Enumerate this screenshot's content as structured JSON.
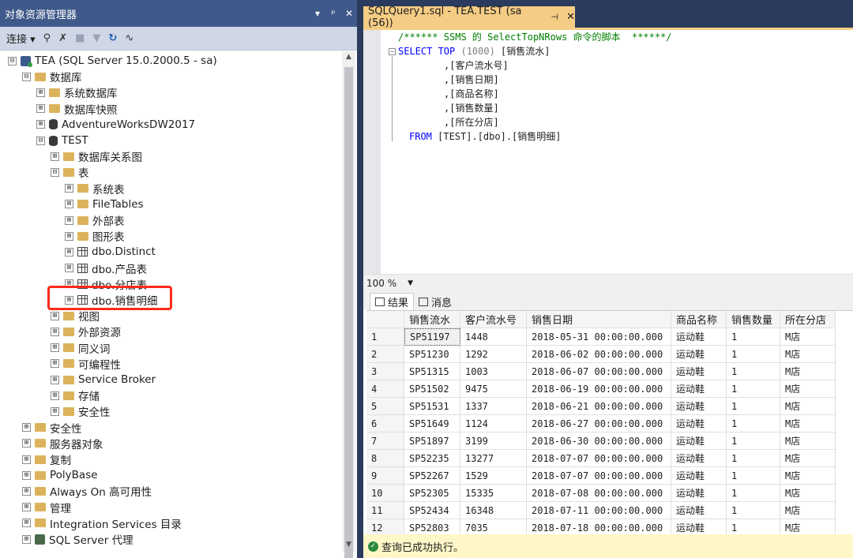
{
  "object_explorer": {
    "title": "对象资源管理器",
    "title_buttons": [
      "▾",
      "ᵖ",
      "✕"
    ],
    "toolbar": {
      "connect_label": "连接 ▾"
    },
    "tree": [
      {
        "label": "TEA (SQL Server 15.0.2000.5 - sa)",
        "icon": "server-icon",
        "expander": "⊟"
      },
      {
        "label": "数据库",
        "icon": "folder-icon",
        "expander": "⊟"
      },
      {
        "label": "系统数据库",
        "icon": "folder-icon",
        "expander": "⊞"
      },
      {
        "label": "数据库快照",
        "icon": "folder-icon",
        "expander": "⊞"
      },
      {
        "label": "AdventureWorksDW2017",
        "icon": "database-icon",
        "expander": "⊞"
      },
      {
        "label": "TEST",
        "icon": "database-icon",
        "expander": "⊟"
      },
      {
        "label": "数据库关系图",
        "icon": "folder-icon",
        "expander": "⊞"
      },
      {
        "label": "表",
        "icon": "folder-icon",
        "expander": "⊟"
      },
      {
        "label": "系统表",
        "icon": "folder-icon",
        "expander": "⊞"
      },
      {
        "label": "FileTables",
        "icon": "folder-icon",
        "expander": "⊞"
      },
      {
        "label": "外部表",
        "icon": "folder-icon",
        "expander": "⊞"
      },
      {
        "label": "图形表",
        "icon": "folder-icon",
        "expander": "⊞"
      },
      {
        "label": "dbo.Distinct",
        "icon": "table-icon",
        "expander": "⊞"
      },
      {
        "label": "dbo.产品表",
        "icon": "table-icon",
        "expander": "⊞"
      },
      {
        "label": "dbo.分店表",
        "icon": "table-icon",
        "expander": "⊞"
      },
      {
        "label": "dbo.销售明细",
        "icon": "table-icon",
        "expander": "⊞"
      },
      {
        "label": "视图",
        "icon": "folder-icon",
        "expander": "⊞"
      },
      {
        "label": "外部资源",
        "icon": "folder-icon",
        "expander": "⊞"
      },
      {
        "label": "同义词",
        "icon": "folder-icon",
        "expander": "⊞"
      },
      {
        "label": "可编程性",
        "icon": "folder-icon",
        "expander": "⊞"
      },
      {
        "label": "Service Broker",
        "icon": "folder-icon",
        "expander": "⊞"
      },
      {
        "label": "存储",
        "icon": "folder-icon",
        "expander": "⊞"
      },
      {
        "label": "安全性",
        "icon": "folder-icon",
        "expander": "⊞"
      },
      {
        "label": "安全性",
        "icon": "folder-icon",
        "expander": "⊞"
      },
      {
        "label": "服务器对象",
        "icon": "folder-icon",
        "expander": "⊞"
      },
      {
        "label": "复制",
        "icon": "folder-icon",
        "expander": "⊞"
      },
      {
        "label": "PolyBase",
        "icon": "folder-icon",
        "expander": "⊞"
      },
      {
        "label": "Always On 高可用性",
        "icon": "folder-icon",
        "expander": "⊞"
      },
      {
        "label": "管理",
        "icon": "folder-icon",
        "expander": "⊞"
      },
      {
        "label": "Integration Services 目录",
        "icon": "folder-icon",
        "expander": "⊞"
      },
      {
        "label": "SQL Server 代理",
        "icon": "agent-icon",
        "expander": "⊞"
      }
    ]
  },
  "query_editor": {
    "tab_title": "SQLQuery1.sql - TEA.TEST (sa (56))",
    "tab_pin": "⊣",
    "tab_close": "✕",
    "code": {
      "line1": "/****** SSMS 的 SelectTopNRows 命令的脚本  ******/",
      "select_kw": "SELECT TOP",
      "top_value": " (1000) ",
      "first_col": "[销售流水]",
      "cols": [
        ",[客户流水号]",
        ",[销售日期]",
        ",[商品名称]",
        ",[销售数量]",
        ",[所在分店]"
      ],
      "from_kw": "FROM",
      "from_target": " [TEST].[dbo].[销售明细]"
    },
    "zoom": "100 %",
    "result_tabs": [
      "结果",
      "消息"
    ],
    "grid": {
      "columns": [
        "销售流水",
        "客户流水号",
        "销售日期",
        "商品名称",
        "销售数量",
        "所在分店"
      ],
      "rows": [
        [
          "1",
          "SP51197",
          "1448",
          "2018-05-31 00:00:00.000",
          "运动鞋",
          "1",
          "M店"
        ],
        [
          "2",
          "SP51230",
          "1292",
          "2018-06-02 00:00:00.000",
          "运动鞋",
          "1",
          "M店"
        ],
        [
          "3",
          "SP51315",
          "1003",
          "2018-06-07 00:00:00.000",
          "运动鞋",
          "1",
          "M店"
        ],
        [
          "4",
          "SP51502",
          "9475",
          "2018-06-19 00:00:00.000",
          "运动鞋",
          "1",
          "M店"
        ],
        [
          "5",
          "SP51531",
          "1337",
          "2018-06-21 00:00:00.000",
          "运动鞋",
          "1",
          "M店"
        ],
        [
          "6",
          "SP51649",
          "1124",
          "2018-06-27 00:00:00.000",
          "运动鞋",
          "1",
          "M店"
        ],
        [
          "7",
          "SP51897",
          "3199",
          "2018-06-30 00:00:00.000",
          "运动鞋",
          "1",
          "M店"
        ],
        [
          "8",
          "SP52235",
          "13277",
          "2018-07-07 00:00:00.000",
          "运动鞋",
          "1",
          "M店"
        ],
        [
          "9",
          "SP52267",
          "1529",
          "2018-07-07 00:00:00.000",
          "运动鞋",
          "1",
          "M店"
        ],
        [
          "10",
          "SP52305",
          "15335",
          "2018-07-08 00:00:00.000",
          "运动鞋",
          "1",
          "M店"
        ],
        [
          "11",
          "SP52434",
          "16348",
          "2018-07-11 00:00:00.000",
          "运动鞋",
          "1",
          "M店"
        ],
        [
          "12",
          "SP52803",
          "7035",
          "2018-07-18 00:00:00.000",
          "运动鞋",
          "1",
          "M店"
        ]
      ]
    },
    "status": "查询已成功执行。"
  }
}
